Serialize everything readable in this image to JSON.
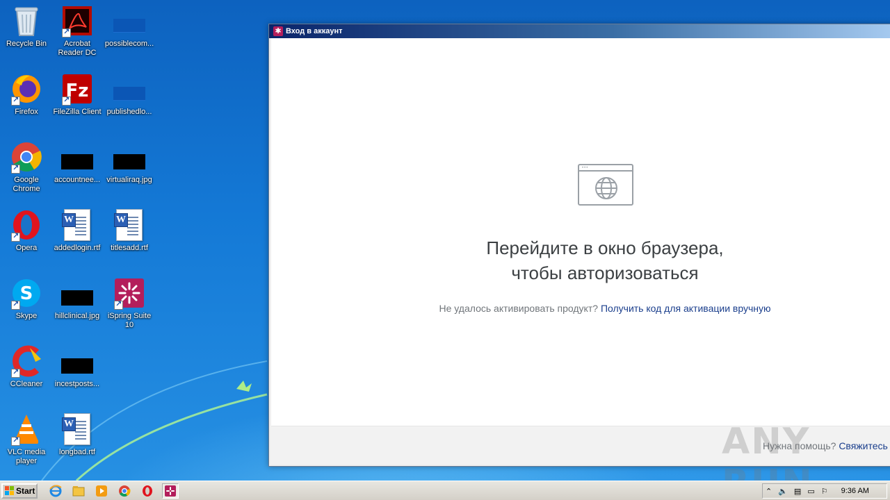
{
  "desktop": {
    "icons": [
      {
        "label": "Recycle Bin",
        "icon": "recycle-bin-icon"
      },
      {
        "label": "Acrobat\nReader DC",
        "icon": "acrobat-icon"
      },
      {
        "label": "possiblecom...",
        "icon": "image-file-icon"
      },
      {
        "label": "Firefox",
        "icon": "firefox-icon"
      },
      {
        "label": "FileZilla Client",
        "icon": "filezilla-icon"
      },
      {
        "label": "publishedlo...",
        "icon": "image-file-icon"
      },
      {
        "label": "Google\nChrome",
        "icon": "chrome-icon"
      },
      {
        "label": "accountnee...",
        "icon": "image-file-icon"
      },
      {
        "label": "virtualiraq.jpg",
        "icon": "image-file-icon"
      },
      {
        "label": "Opera",
        "icon": "opera-icon"
      },
      {
        "label": "addedlogin.rtf",
        "icon": "word-doc-icon"
      },
      {
        "label": "titlesadd.rtf",
        "icon": "word-doc-icon"
      },
      {
        "label": "Skype",
        "icon": "skype-icon"
      },
      {
        "label": "hillclinical.jpg",
        "icon": "image-file-icon"
      },
      {
        "label": "iSpring Suite\n10",
        "icon": "ispring-icon"
      },
      {
        "label": "CCleaner",
        "icon": "ccleaner-icon"
      },
      {
        "label": "incestposts...",
        "icon": "image-file-icon"
      },
      {
        "label": "VLC media\nplayer",
        "icon": "vlc-icon"
      },
      {
        "label": "longbad.rtf",
        "icon": "word-doc-icon"
      }
    ]
  },
  "window": {
    "title": "Вход в аккаунт",
    "heading_line1": "Перейдите в окно браузера,",
    "heading_line2": "чтобы авторизоваться",
    "activation_prompt": "Не удалось активировать продукт?",
    "activation_link": "Получить код для активации вручную",
    "help_prompt": "Нужна помощь?",
    "help_link": "Свяжитесь"
  },
  "watermark": "ANY RUN",
  "taskbar": {
    "start_label": "Start",
    "clock": "9:36 AM",
    "quick_launch": [
      "ie-icon",
      "explorer-icon",
      "media-player-icon",
      "chrome-icon",
      "opera-icon",
      "ispring-icon"
    ]
  },
  "colors": {
    "link": "#1a3e8c",
    "heading": "#3c4043",
    "muted": "#70757a",
    "ispring": "#b31e5b"
  }
}
